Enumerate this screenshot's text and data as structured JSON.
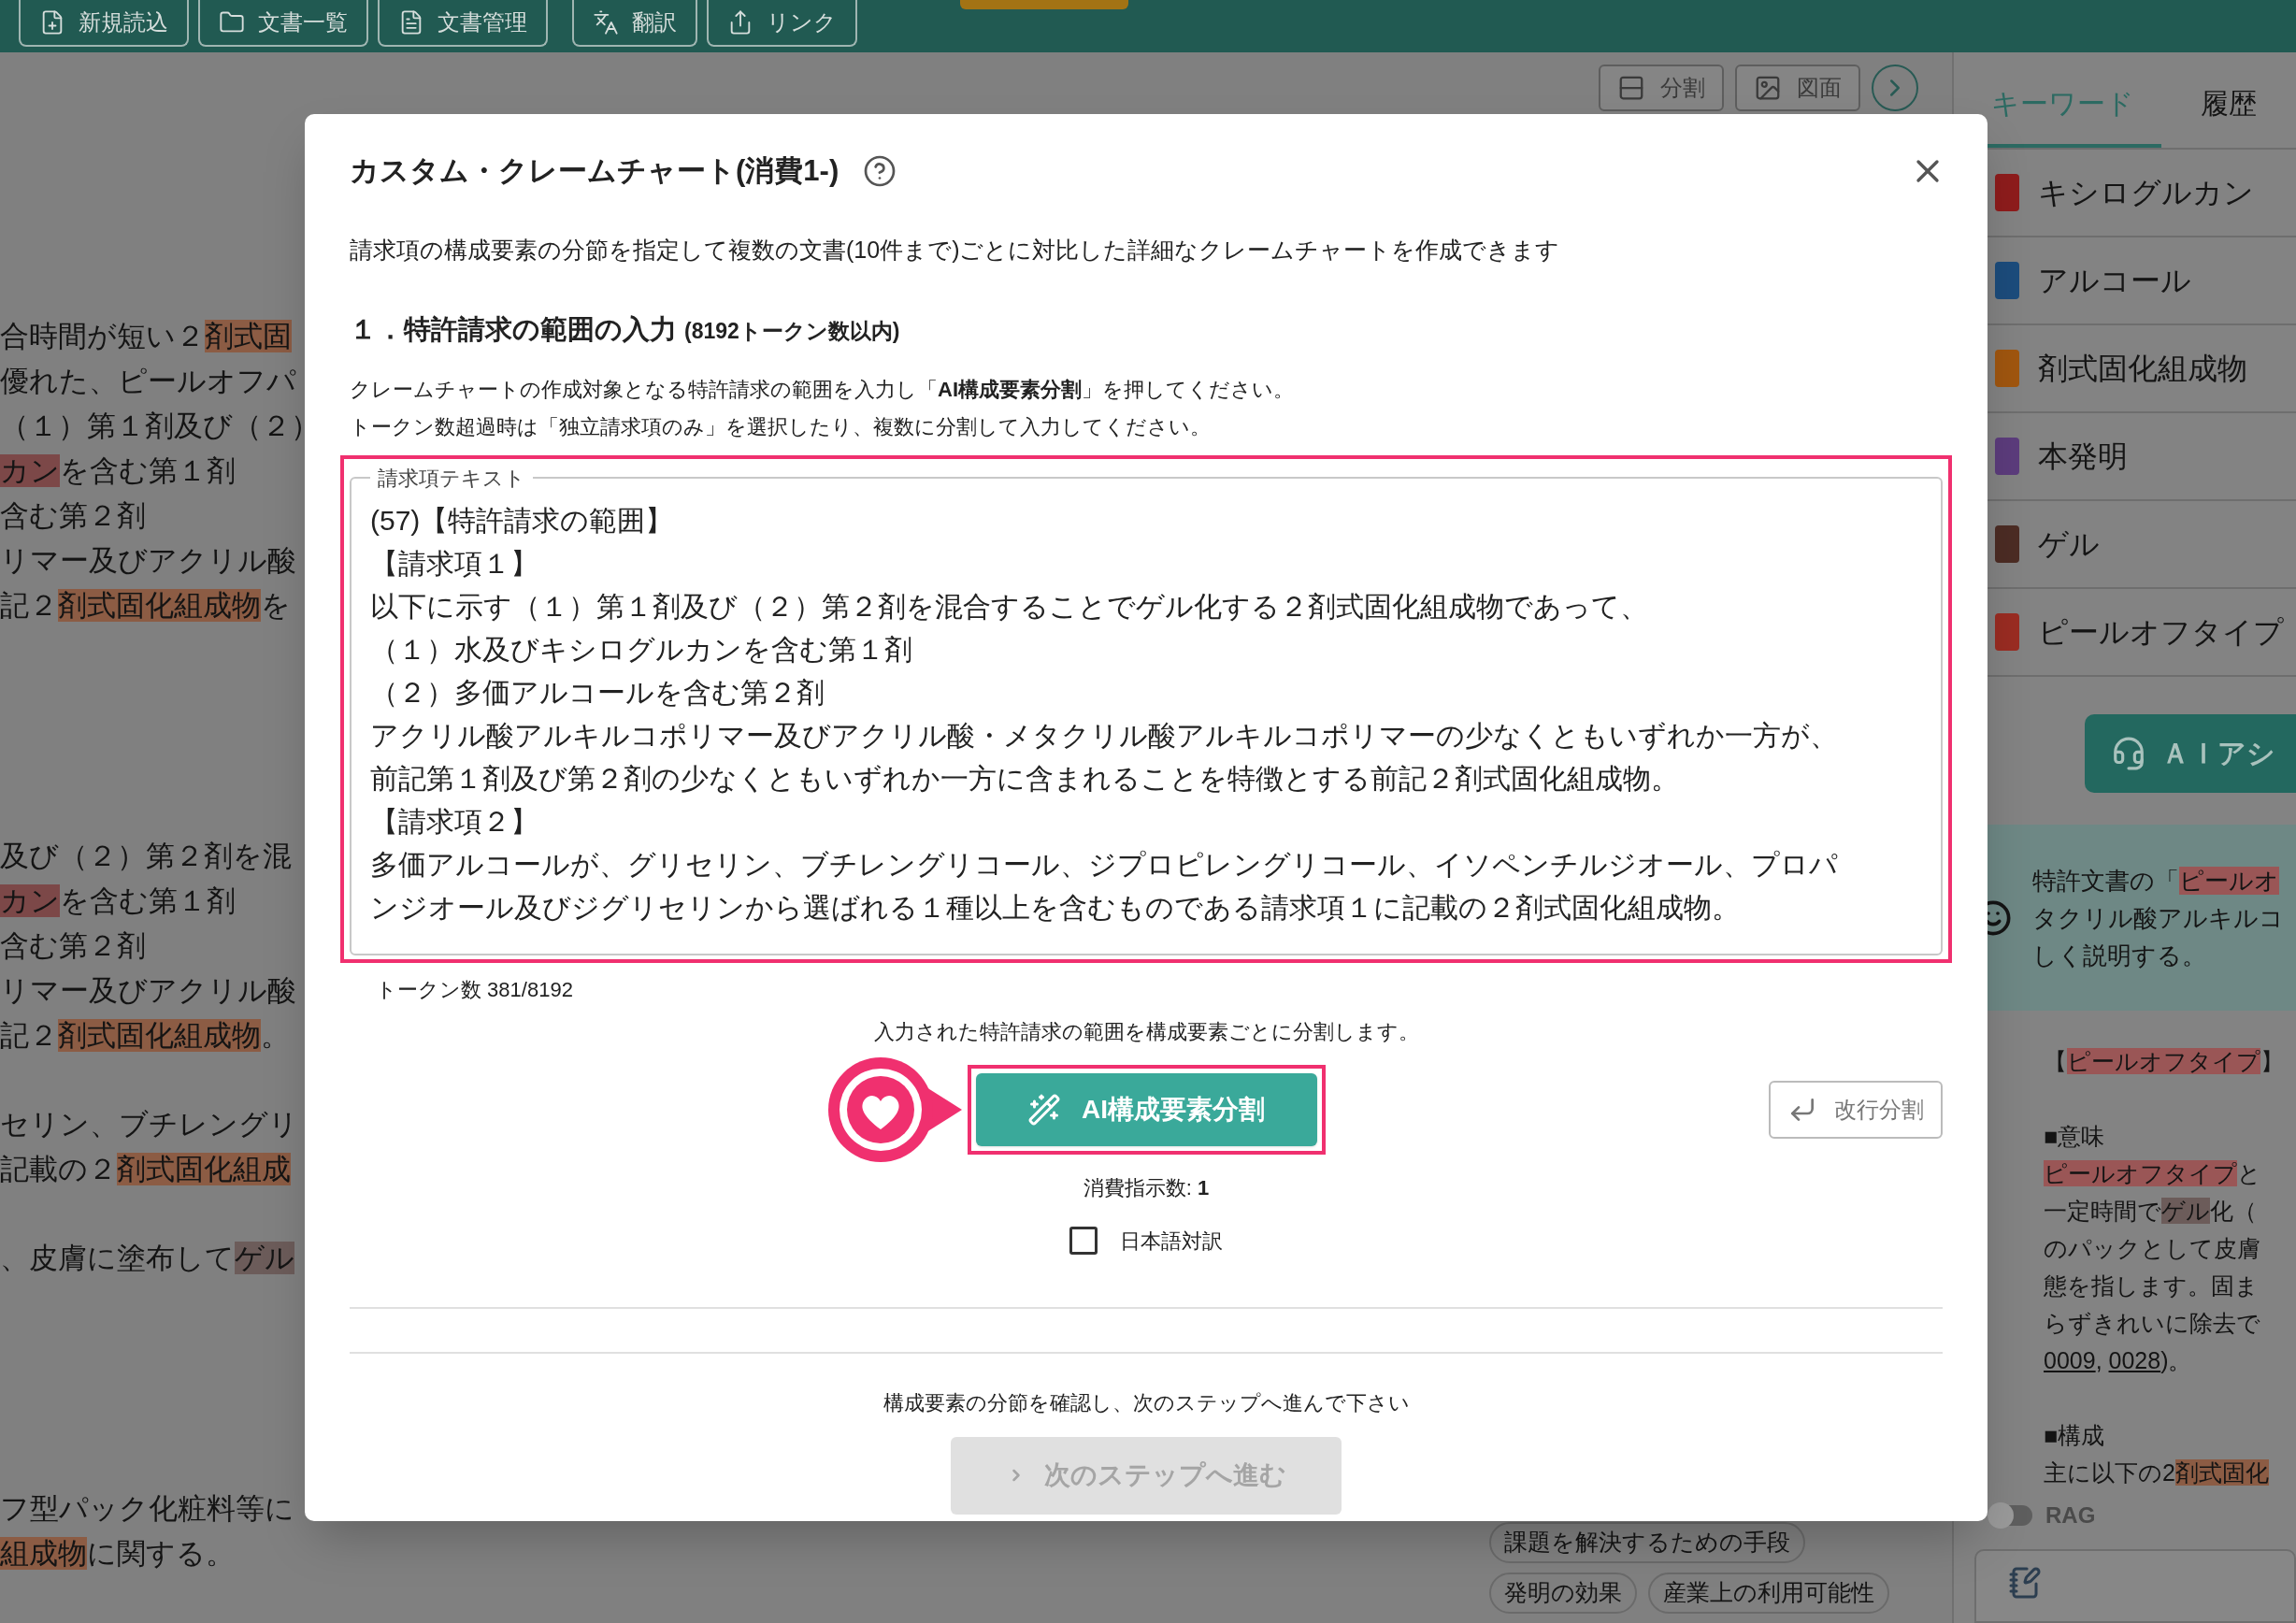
{
  "toolbar": {
    "buttons": [
      {
        "label": "新規読込"
      },
      {
        "label": "文書一覧"
      },
      {
        "label": "文書管理"
      },
      {
        "label": "翻訳"
      },
      {
        "label": "リンク"
      }
    ]
  },
  "view_buttons": [
    {
      "label": "分割"
    },
    {
      "label": "図面"
    }
  ],
  "document": {
    "paragraphs": [
      [
        [
          {
            "text": "合時間が短い２"
          },
          {
            "text": "剤式固",
            "color": "#8c5c44"
          }
        ],
        [
          {
            "text": "優れた、ピールオフパ"
          }
        ],
        [
          {
            "text": "（１）第１剤及び（２）"
          }
        ],
        [
          {
            "text": "カン",
            "color": "#7c4848"
          },
          {
            "text": "を含む第１剤"
          }
        ],
        [
          {
            "text": "含む第２剤"
          }
        ],
        [
          {
            "text": "リマー及びアクリル酸"
          }
        ],
        [
          {
            "text": "記２"
          },
          {
            "text": "剤式固化組成物",
            "color": "#8c5c44"
          },
          {
            "text": "を"
          }
        ]
      ],
      [
        [
          {
            "text": "及び（２）第２剤を混"
          }
        ],
        [
          {
            "text": "カン",
            "color": "#7c4848"
          },
          {
            "text": "を含む第１剤"
          }
        ],
        [
          {
            "text": "含む第２剤"
          }
        ],
        [
          {
            "text": "リマー及びアクリル酸"
          }
        ],
        [
          {
            "text": "記２"
          },
          {
            "text": "剤式固化組成物",
            "color": "#8c5c44"
          },
          {
            "text": "。"
          }
        ]
      ],
      [
        [
          {
            "text": "セリン、ブチレングリ"
          }
        ],
        [
          {
            "text": "記載の２"
          },
          {
            "text": "剤式固化組成",
            "color": "#8c5c44"
          }
        ]
      ],
      [
        [
          {
            "text": "、皮膚に塗布して"
          },
          {
            "text": "ゲル",
            "color": "#6c5c5a"
          }
        ]
      ],
      [
        [
          {
            "text": "フ型パック化粧料等に"
          }
        ],
        [
          {
            "text": "組成物",
            "color": "#8c5c44"
          },
          {
            "text": "に関する。"
          }
        ]
      ]
    ]
  },
  "section_tags": [
    {
      "label": "課題を解決するための手段"
    },
    {
      "label": "発明の効果"
    },
    {
      "label": "産業上の利用可能性"
    }
  ],
  "side_panel": {
    "tabs": [
      {
        "label": "キーワード",
        "selected": true
      },
      {
        "label": "履歴",
        "selected": false
      }
    ],
    "keywords": [
      {
        "label": "キシログルカン",
        "color": "#8e1c1c"
      },
      {
        "label": "アルコール",
        "color": "#1c4c7c"
      },
      {
        "label": "剤式固化組成物",
        "color": "#a0560f"
      },
      {
        "label": "本発明",
        "color": "#5c3c7c"
      },
      {
        "label": "ゲル",
        "color": "#4c2c24"
      },
      {
        "label": "ピールオフタイプ",
        "color": "#9a2c22"
      }
    ],
    "assistant_button": {
      "label": "ＡＩアシ"
    },
    "question": [
      [
        {
          "text": "特許文書の「"
        },
        {
          "text": "ピールオ",
          "color": "#9a5656"
        }
      ],
      [
        {
          "text": "タクリル酸アルキルコ"
        }
      ],
      [
        {
          "text": "しく説明する。"
        }
      ]
    ],
    "answer": [
      [
        [
          {
            "text": "【"
          },
          {
            "text": "ピールオフタイプ",
            "color": "#9a5656"
          },
          {
            "text": "】"
          }
        ]
      ],
      [
        [
          {
            "text": "■意味"
          }
        ],
        [
          {
            "text": "ピールオフタイプ",
            "color": "#9a5656"
          },
          {
            "text": "と"
          }
        ],
        [
          {
            "text": "一定時間で"
          },
          {
            "text": "ゲル",
            "color": "#6c5c5a"
          },
          {
            "text": "化（"
          }
        ],
        [
          {
            "text": "のパックとして皮膚"
          }
        ],
        [
          {
            "text": "態を指します。固ま"
          }
        ],
        [
          {
            "text": "らずきれいに除去で"
          }
        ],
        [
          {
            "text": "0009",
            "kind": "link"
          },
          {
            "text": ", "
          },
          {
            "text": "0028",
            "kind": "link"
          },
          {
            "text": ")。"
          }
        ]
      ],
      [
        [
          {
            "text": "■構成"
          }
        ],
        [
          {
            "text": "主に以下の2"
          },
          {
            "text": "剤式固化",
            "color": "#8c5c44"
          }
        ]
      ]
    ],
    "rag": {
      "label": "RAG",
      "on": false
    }
  },
  "dialog": {
    "title": "カスタム・クレームチャート(消費1-)",
    "description": "請求項の構成要素の分節を指定して複数の文書(10件まで)ごとに対比した詳細なクレームチャートを作成できます",
    "section_title": "１．特許請求の範囲の入力",
    "section_note": "(8192トークン数以内)",
    "instructions": [
      "クレームチャートの作成対象となる特許請求の範囲を入力し「**AI構成要素分割**」を押してください。",
      "トークン数超過時は「独立請求項のみ」を選択したり、複数に分割して入力してください。"
    ],
    "claim_field": {
      "legend": "請求項テキスト",
      "lines": [
        "(57)【特許請求の範囲】",
        "【請求項１】",
        "以下に示す（１）第１剤及び（２）第２剤を混合することでゲル化する２剤式固化組成物であって、",
        "（１）水及びキシログルカンを含む第１剤",
        "（２）多価アルコールを含む第２剤",
        "アクリル酸アルキルコポリマー及びアクリル酸・メタクリル酸アルキルコポリマーの少なくともいずれか一方が、",
        "前記第１剤及び第２剤の少なくともいずれか一方に含まれることを特徴とする前記２剤式固化組成物。",
        "【請求項２】",
        "多価アルコールが、グリセリン、ブチレングリコール、ジプロピレングリコール、イソペンチルジオール、プロパ",
        "ンジオール及びジグリセリンから選ばれる１種以上を含むものである請求項１に記載の２剤式固化組成物。"
      ]
    },
    "token_count": "トークン数 381/8192",
    "split_hint": "入力された特許請求の範囲を構成要素ごとに分割します。",
    "ai_split_button": "AI構成要素分割",
    "line_split_button": "改行分割",
    "consumption": "消費指示数: **1**",
    "translation_checkbox": {
      "label": "日本語対訳",
      "checked": false
    },
    "next_hint": "構成要素の分節を確認し、次のステップへ進んで下さい",
    "next_button": {
      "label": "次のステップへ進む",
      "disabled": true
    }
  }
}
